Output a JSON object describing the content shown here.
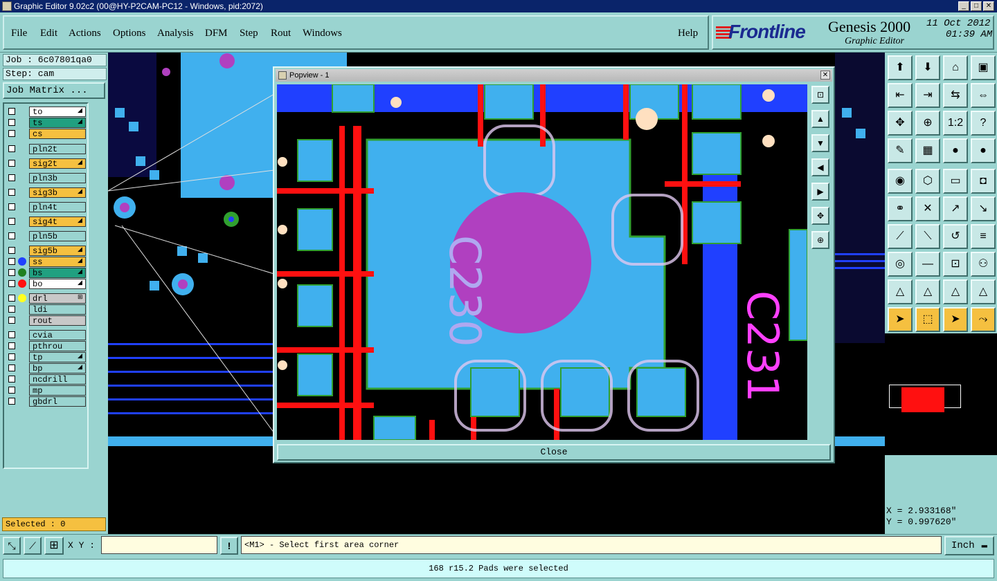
{
  "window": {
    "title": "Graphic Editor 9.02c2 (00@HY-P2CAM-PC12 - Windows, pid:2072)"
  },
  "menu": {
    "items": [
      "File",
      "Edit",
      "Actions",
      "Options",
      "Analysis",
      "DFM",
      "Step",
      "Rout",
      "Windows"
    ],
    "help": "Help"
  },
  "brand": {
    "logo": "Frontline",
    "product": "Genesis 2000",
    "subtitle": "Graphic Editor",
    "date": "11 Oct 2012",
    "time": "01:39 AM"
  },
  "job": {
    "label": "Job : 6c07801qa0",
    "step": "Step: cam",
    "matrix_button": "Job Matrix ..."
  },
  "layers": [
    {
      "name": "to",
      "color": "#ffffff",
      "mark": "◢",
      "dot": ""
    },
    {
      "name": "ts",
      "color": "#20a080",
      "mark": "◢",
      "dot": ""
    },
    {
      "name": "cs",
      "color": "#f5c040",
      "mark": "",
      "dot": ""
    },
    {
      "name": "pln2t",
      "color": "#9ad4d0",
      "mark": "",
      "dot": ""
    },
    {
      "name": "sig2t",
      "color": "#f5c040",
      "mark": "◢",
      "dot": ""
    },
    {
      "name": "pln3b",
      "color": "#9ad4d0",
      "mark": "",
      "dot": ""
    },
    {
      "name": "sig3b",
      "color": "#f5c040",
      "mark": "◢",
      "dot": ""
    },
    {
      "name": "pln4t",
      "color": "#9ad4d0",
      "mark": "",
      "dot": ""
    },
    {
      "name": "sig4t",
      "color": "#f5c040",
      "mark": "◢",
      "dot": ""
    },
    {
      "name": "pln5b",
      "color": "#9ad4d0",
      "mark": "",
      "dot": ""
    },
    {
      "name": "sig5b",
      "color": "#f5c040",
      "mark": "◢",
      "dot": ""
    },
    {
      "name": "ss",
      "color": "#f5c040",
      "mark": "◢",
      "dot": "#2040ff"
    },
    {
      "name": "bs",
      "color": "#20a080",
      "mark": "◢",
      "dot": "#208020"
    },
    {
      "name": "bo",
      "color": "#ffffff",
      "mark": "◢",
      "dot": "#ff1010"
    },
    {
      "name": "drl",
      "color": "#c8c8c8",
      "mark": "⊞",
      "dot": "#ffff20"
    },
    {
      "name": "ldi",
      "color": "#9ad4d0",
      "mark": "",
      "dot": ""
    },
    {
      "name": "rout",
      "color": "#c8c8c8",
      "mark": "",
      "dot": ""
    },
    {
      "name": "cvia",
      "color": "#9ad4d0",
      "mark": "",
      "dot": ""
    },
    {
      "name": "pthrou",
      "color": "#9ad4d0",
      "mark": "",
      "dot": ""
    },
    {
      "name": "tp",
      "color": "#9ad4d0",
      "mark": "◢",
      "dot": ""
    },
    {
      "name": "bp",
      "color": "#9ad4d0",
      "mark": "◢",
      "dot": ""
    },
    {
      "name": "ncdrill",
      "color": "#9ad4d0",
      "mark": "",
      "dot": ""
    },
    {
      "name": "mp",
      "color": "#9ad4d0",
      "mark": "",
      "dot": ""
    },
    {
      "name": "gbdrl",
      "color": "#9ad4d0",
      "mark": "",
      "dot": ""
    }
  ],
  "selected": "Selected : 0",
  "popview": {
    "title": "Popview - 1",
    "close": "Close",
    "silk_labels": [
      "C230",
      "C231"
    ]
  },
  "coords": {
    "x": "X = 2.933168\"",
    "y": "Y = 0.997620\""
  },
  "cmd": {
    "xy_label": "X Y :",
    "xy_value": "",
    "prompt": "<M1> - Select first area corner",
    "units": "Inch"
  },
  "status": "168 r15.2 Pads were selected",
  "colors": {
    "panel": "#9ad4d0",
    "copper": "#40b0ee",
    "trace": "#ff1010",
    "pad_violet": "#b040c0",
    "silk": "#ff40ff"
  }
}
